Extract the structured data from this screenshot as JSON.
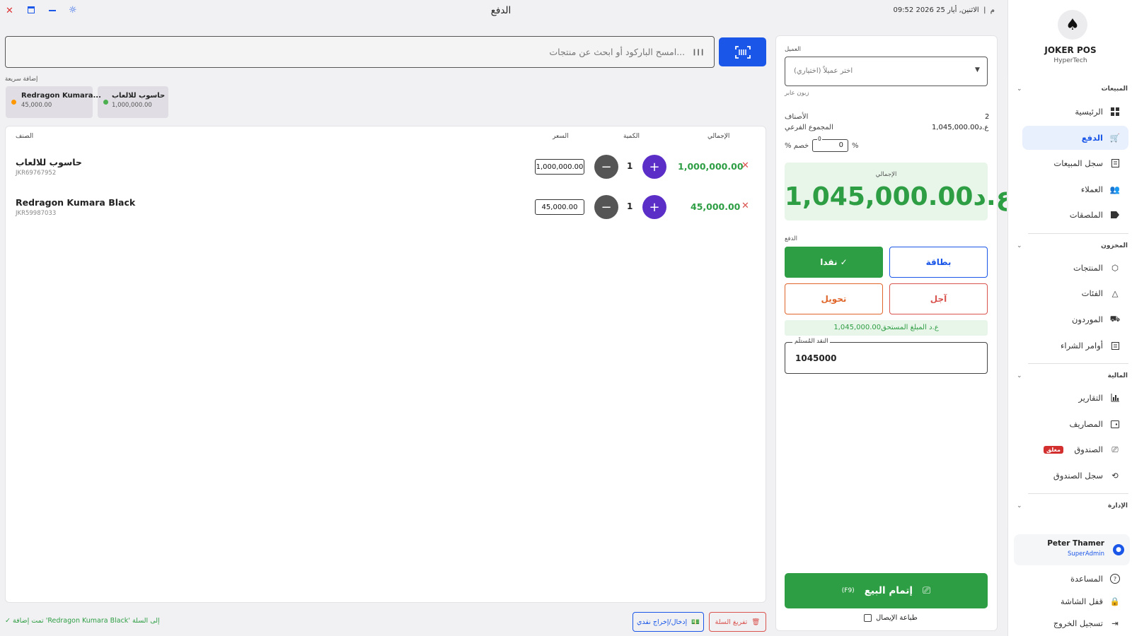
{
  "window": {
    "title": "الدفع",
    "datetime": "09:52 م  |  الاثنين, أيار 25 2026"
  },
  "sidebar": {
    "app_name": "JOKER POS",
    "company": "HyperTech",
    "sections": {
      "sales": "المبيعات",
      "inventory": "المخزون",
      "finance": "المالية",
      "admin": "الإدارة"
    },
    "items": {
      "home": "الرئيسية",
      "checkout": "الدفع",
      "sales_log": "سجل المبيعات",
      "customers": "العملاء",
      "labels": "الملصقات",
      "products": "المنتجات",
      "categories": "الفئات",
      "suppliers": "الموردون",
      "purchase_orders": "أوامر الشراء",
      "reports": "التقارير",
      "expenses": "المصاريف",
      "cashbox": "الصندوق",
      "cashbox_badge": "مغلق",
      "cashbox_log": "سجل الصندوق"
    },
    "user": {
      "name": "Peter Thamer",
      "role": "SuperAdmin"
    },
    "footer": {
      "help": "المساعدة",
      "lock": "قفل الشاشة",
      "logout": "تسجيل الخروج"
    }
  },
  "search": {
    "placeholder": "امسح الباركود أو ابحث عن منتجات..."
  },
  "quick_add": {
    "label": "إضافة سريعة",
    "items": [
      {
        "name": "حاسوب للالعاب",
        "price": "1,000,000.00",
        "dot_color": "#4caf50"
      },
      {
        "name": "Redragon Kumara...",
        "price": "45,000.00",
        "dot_color": "#ff9800"
      }
    ]
  },
  "cart": {
    "headers": {
      "item": "الصنف",
      "price": "السعر",
      "qty": "الكمية",
      "total": "الإجمالي"
    },
    "rows": [
      {
        "name": "حاسوب للالعاب",
        "sku": "JKR69767952",
        "price": "1,000,000.00",
        "qty": "1",
        "total": "1,000,000.00"
      },
      {
        "name": "Redragon Kumara Black",
        "sku": "JKR59987033",
        "price": "45,000.00",
        "qty": "1",
        "total": "45,000.00"
      }
    ]
  },
  "footer_bar": {
    "status": "✓ تمت إضافة 'Redragon Kumara Black' إلى السلة",
    "cash_io": "إدخال/إخراج نقدي",
    "clear_cart": "تفريغ السلة"
  },
  "checkout": {
    "customer_label": "العميل",
    "customer_placeholder": "(اختر عميلاً (اختياري",
    "walkin": "زبون عابر",
    "items_label": "الأصناف",
    "items_count": "2",
    "subtotal_label": "المجموع الفرعي",
    "subtotal_value": "1,045,000.00ع.د",
    "discount_label": "% خصم",
    "discount_value": "0",
    "discount_small": "0",
    "discount_pct": "%",
    "total_label": "الإجمالي",
    "total_value": "1,045,000.00ع.د",
    "payment_label": "الدفع",
    "methods": {
      "cash": "نقدا ✓",
      "card": "بطاقة",
      "transfer": "تحويل",
      "deferred": "آجل"
    },
    "due_text": "1,045,000.00ع.د  المبلغ المستحق",
    "received_label": "النقد المُستلَم",
    "received_value": "1045000",
    "complete_label": "إتمام البيع",
    "complete_shortcut": "(F9)",
    "print_receipt": "طباعة الإيصال"
  },
  "colors": {
    "primary": "#1a56e8",
    "success": "#2e9e44",
    "purple": "#5b2fc7",
    "danger": "#d9534f",
    "active_nav_bg": "#e8f0fe"
  }
}
